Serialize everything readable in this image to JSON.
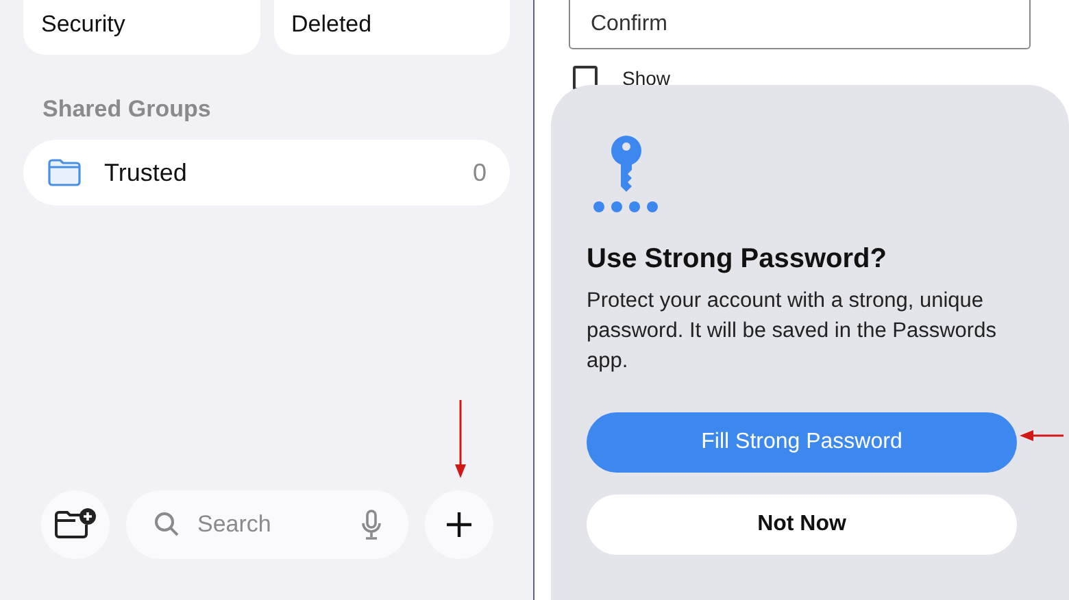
{
  "passwords_app": {
    "categories": [
      {
        "label": "Security"
      },
      {
        "label": "Deleted"
      }
    ],
    "section_heading": "Shared Groups",
    "groups": [
      {
        "name": "Trusted",
        "count": "0"
      }
    ],
    "toolbar": {
      "search": {
        "placeholder": "Search"
      }
    }
  },
  "web_form": {
    "confirm_field": {
      "placeholder": "Confirm"
    },
    "show_password": {
      "label": "Show",
      "checked": false
    }
  },
  "sheet": {
    "title": "Use Strong Password?",
    "message": "Protect your account with a strong, unique password. It will be saved in the Passwords app.",
    "buttons": [
      {
        "label": "Fill Strong Password",
        "kind": "primary"
      },
      {
        "label": "Not Now",
        "kind": "secondary"
      }
    ]
  }
}
